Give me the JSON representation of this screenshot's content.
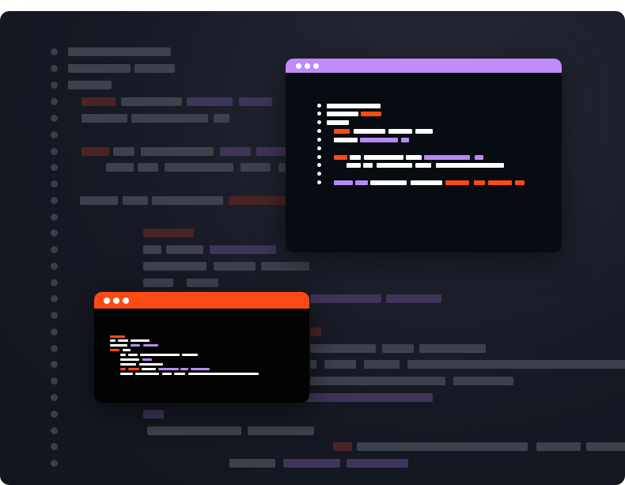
{
  "illustration": {
    "colors": {
      "background_panel": "#161923",
      "skeleton_bar": "#3d414c",
      "skeleton_bar_purple": "#3e3558",
      "skeleton_bar_red": "#4a2424",
      "code_window_bg": "#070b12",
      "accent_purple": "#c08cfa",
      "accent_orange": "#fb4a16",
      "code_white": "#ffffff",
      "code_orange": "#ff4a14",
      "code_purple": "#b88af5"
    },
    "icons": [
      "window-control-dot"
    ]
  }
}
